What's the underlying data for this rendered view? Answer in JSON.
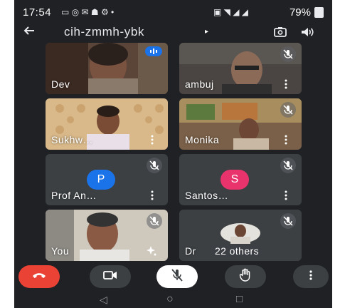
{
  "status_bar": {
    "time": "17:54",
    "battery": "79%"
  },
  "meeting": {
    "code": "cih-zmmh-ybk",
    "caret": "▸"
  },
  "tiles": [
    {
      "name": "Dev",
      "video": true,
      "speaking": true
    },
    {
      "name": "ambuj",
      "video": true,
      "muted": true
    },
    {
      "name": "Sukhw…",
      "video": true
    },
    {
      "name": "Monika",
      "video": true,
      "muted": true
    },
    {
      "name": "Prof An…",
      "video": false,
      "avatar_letter": "P",
      "avatar_color": "#1a73e8",
      "muted": true
    },
    {
      "name": "Santos…",
      "video": false,
      "avatar_letter": "S",
      "avatar_color": "#e8336d",
      "muted": true
    },
    {
      "name": "You",
      "video": true,
      "muted": true
    },
    {
      "name": "Dr",
      "video": true,
      "muted": true,
      "overflow_label": "22 others"
    }
  ],
  "controls": [
    {
      "id": "end-call",
      "icon": "phone-hangup-icon",
      "color": "#ea4335"
    },
    {
      "id": "camera",
      "icon": "video-camera-icon"
    },
    {
      "id": "microphone",
      "icon": "mic-off-icon",
      "state": "muted"
    },
    {
      "id": "raise-hand",
      "icon": "hand-icon"
    },
    {
      "id": "more-options",
      "icon": "more-vert-icon"
    }
  ],
  "nav": {
    "back": "◁",
    "home": "○",
    "recent": "□"
  }
}
